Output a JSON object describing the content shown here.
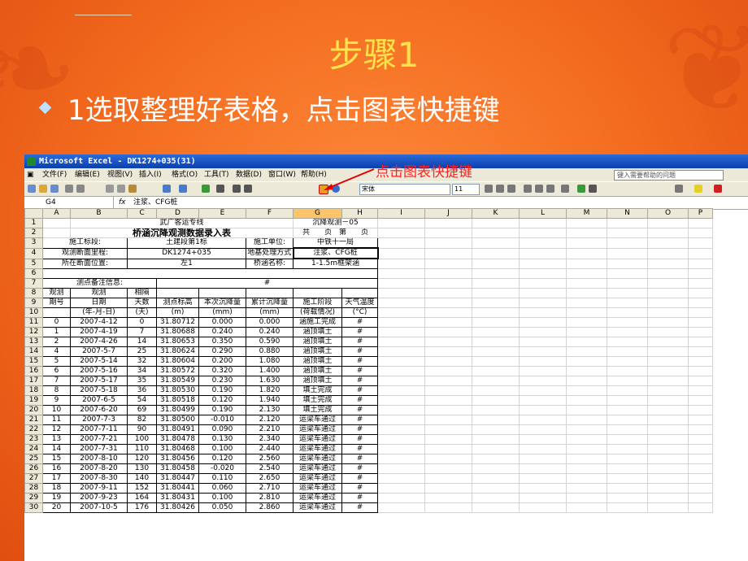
{
  "slide": {
    "title": "步骤1",
    "bullet": "1选取整理好表格，点击图表快捷键",
    "callout": "点击图表快捷键"
  },
  "excel": {
    "window_title": "Microsoft Excel - DK1274+035(31)",
    "menu": [
      "文件(F)",
      "编辑(E)",
      "视图(V)",
      "插入(I)",
      "格式(O)",
      "工具(T)",
      "数据(D)",
      "窗口(W)",
      "帮助(H)"
    ],
    "help_placeholder": "键入需要帮助的问题",
    "font_name": "宋体",
    "font_size": "11",
    "name_box": "G4",
    "fx": "fx",
    "formula": "注浆、CFG桩",
    "columns": [
      "A",
      "B",
      "C",
      "D",
      "E",
      "F",
      "G",
      "H",
      "I",
      "J",
      "K",
      "L",
      "M",
      "N",
      "O",
      "P"
    ],
    "header_rows": {
      "r1_title": "武广客运专线",
      "r1_right": "沉降观测－05",
      "r2_title": "桥涵沉降观测数据录入表",
      "r2_right": "共　　页　第　　页",
      "r3_label": "施工标段:",
      "r3_value": "土建段第1标",
      "r3_label2": "施工单位:",
      "r3_value2": "中铁十一局",
      "r4_label": "观测断面里程:",
      "r4_value": "DK1274+035",
      "r4_label2": "地基处理方式",
      "r4_value2": "注浆、CFG桩",
      "r5_label": "所在断面位置:",
      "r5_value": "左1",
      "r5_label2": "桥涵名称:",
      "r5_value2": "1-1.5m框架涵",
      "r7_label": "测点备注信息:",
      "r7_hash": "#",
      "h8": [
        "观测",
        "观测",
        "相隔",
        "",
        "",
        "",
        "",
        ""
      ],
      "h9": [
        "期号",
        "日期",
        "天数",
        "测点标高",
        "本次沉降量",
        "累计沉降量",
        "施工阶段",
        "天气温度"
      ],
      "h10": [
        "",
        "(年-月-日)",
        "(天)",
        "(m)",
        "(mm)",
        "(mm)",
        "(荷载情况)",
        "(°C)"
      ]
    },
    "row_numbers": [
      "1",
      "2",
      "3",
      "4",
      "5",
      "6",
      "7",
      "8",
      "9",
      "10",
      "11",
      "12",
      "13",
      "14",
      "15",
      "16",
      "17",
      "18",
      "19",
      "20",
      "21",
      "22",
      "23",
      "24",
      "25",
      "26",
      "27",
      "28",
      "29",
      "30"
    ],
    "data_rows": [
      [
        "0",
        "2007-4-12",
        "0",
        "31.80712",
        "0.000",
        "0.000",
        "涵施工完成",
        "#"
      ],
      [
        "1",
        "2007-4-19",
        "7",
        "31.80688",
        "0.240",
        "0.240",
        "涵顶填土",
        "#"
      ],
      [
        "2",
        "2007-4-26",
        "14",
        "31.80653",
        "0.350",
        "0.590",
        "涵顶填土",
        "#"
      ],
      [
        "4",
        "2007-5-7",
        "25",
        "31.80624",
        "0.290",
        "0.880",
        "涵顶填土",
        "#"
      ],
      [
        "5",
        "2007-5-14",
        "32",
        "31.80604",
        "0.200",
        "1.080",
        "涵顶填土",
        "#"
      ],
      [
        "6",
        "2007-5-16",
        "34",
        "31.80572",
        "0.320",
        "1.400",
        "涵顶填土",
        "#"
      ],
      [
        "7",
        "2007-5-17",
        "35",
        "31.80549",
        "0.230",
        "1.630",
        "涵顶填土",
        "#"
      ],
      [
        "8",
        "2007-5-18",
        "36",
        "31.80530",
        "0.190",
        "1.820",
        "填土完成",
        "#"
      ],
      [
        "9",
        "2007-6-5",
        "54",
        "31.80518",
        "0.120",
        "1.940",
        "填土完成",
        "#"
      ],
      [
        "10",
        "2007-6-20",
        "69",
        "31.80499",
        "0.190",
        "2.130",
        "填土完成",
        "#"
      ],
      [
        "11",
        "2007-7-3",
        "82",
        "31.80500",
        "-0.010",
        "2.120",
        "运梁车通过",
        "#"
      ],
      [
        "12",
        "2007-7-11",
        "90",
        "31.80491",
        "0.090",
        "2.210",
        "运梁车通过",
        "#"
      ],
      [
        "13",
        "2007-7-21",
        "100",
        "31.80478",
        "0.130",
        "2.340",
        "运梁车通过",
        "#"
      ],
      [
        "14",
        "2007-7-31",
        "110",
        "31.80468",
        "0.100",
        "2.440",
        "运梁车通过",
        "#"
      ],
      [
        "15",
        "2007-8-10",
        "120",
        "31.80456",
        "0.120",
        "2.560",
        "运梁车通过",
        "#"
      ],
      [
        "16",
        "2007-8-20",
        "130",
        "31.80458",
        "-0.020",
        "2.540",
        "运梁车通过",
        "#"
      ],
      [
        "17",
        "2007-8-30",
        "140",
        "31.80447",
        "0.110",
        "2.650",
        "运梁车通过",
        "#"
      ],
      [
        "18",
        "2007-9-11",
        "152",
        "31.80441",
        "0.060",
        "2.710",
        "运梁车通过",
        "#"
      ],
      [
        "19",
        "2007-9-23",
        "164",
        "31.80431",
        "0.100",
        "2.810",
        "运梁车通过",
        "#"
      ],
      [
        "20",
        "2007-10-5",
        "176",
        "31.80426",
        "0.050",
        "2.860",
        "运梁车通过",
        "#"
      ]
    ]
  }
}
